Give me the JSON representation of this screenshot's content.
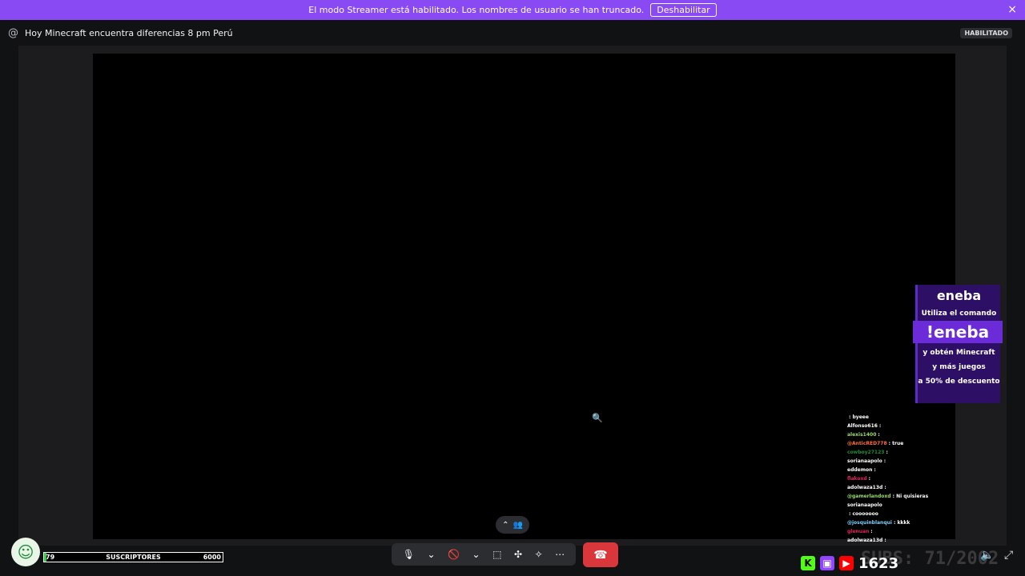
{
  "banner": {
    "text": "El modo Streamer está habilitado. Los nombres de usuario se han truncado.",
    "button": "Deshabilitar",
    "close_icon": "×"
  },
  "header": {
    "at_icon": "@",
    "title": "Hoy Minecraft encuentra diferencias 8 pm Perú",
    "badge": "HABILITADO"
  },
  "call": {
    "pill_up": "⌃",
    "pill_people": "👥",
    "mic": "🎙",
    "mic_arrow": "⌄",
    "camera": "🚫",
    "camera_arrow": "⌄",
    "share": "⬚",
    "activities": "✣",
    "soundboard": "✧",
    "more": "⋯",
    "hangup": "☎"
  },
  "overlay": {
    "subs": {
      "label": "SUSCRIPTORES",
      "current": "79",
      "goal": "6000",
      "progress": 0.013
    },
    "avatar_icon": "☺",
    "eneba": {
      "logo": "eneba",
      "line1": "Utiliza el comando",
      "command": "!eneba",
      "line2": "y obtén Minecraft",
      "line3": "y más juegos",
      "line4": "a 50% de descuento"
    },
    "chat": [
      {
        "user": "",
        "msg": ": byeee",
        "color": "#4a6cf7"
      },
      {
        "user": "Alfonso616",
        "msg": ":",
        "color": "#ffffff"
      },
      {
        "user": "alexis1400",
        "msg": ":",
        "color": "#9bd96f"
      },
      {
        "user": "@AnticRED778",
        "msg": ": true",
        "color": "#ff6f3b"
      },
      {
        "user": "cowboy27123",
        "msg": ":",
        "color": "#1e8b3a"
      },
      {
        "user": "sorianaapolo",
        "msg": ":",
        "color": "#ffffff"
      },
      {
        "user": "eddemon",
        "msg": ":",
        "color": "#ffffff"
      },
      {
        "user": "flakoxd",
        "msg": ":",
        "color": "#e0245e"
      },
      {
        "user": "adolwaza13d",
        "msg": ":",
        "color": "#ffffff"
      },
      {
        "user": "@gamerlandoxd",
        "msg": ": Ni quisieras",
        "color": "#9bd96f"
      },
      {
        "user": "sorianaapolo",
        "msg": "",
        "color": "#ffffff"
      },
      {
        "user": "",
        "msg": ": cooooooo",
        "color": "#4a6cf7"
      },
      {
        "user": "@josquinblanqui",
        "msg": ": kkkk",
        "color": "#7fd1ff"
      },
      {
        "user": "glenuan",
        "msg": ":",
        "color": "#e0245e"
      },
      {
        "user": "adolwaza13d",
        "msg": ":",
        "color": "#ffffff"
      }
    ],
    "viewer_count": "1623",
    "kick_icon": "K",
    "twitch_icon": "▣",
    "youtube_icon": "▶",
    "watermark": "SUBS: 71/2002",
    "volume_icon": "🔈",
    "fullscreen_icon": "⤢"
  }
}
